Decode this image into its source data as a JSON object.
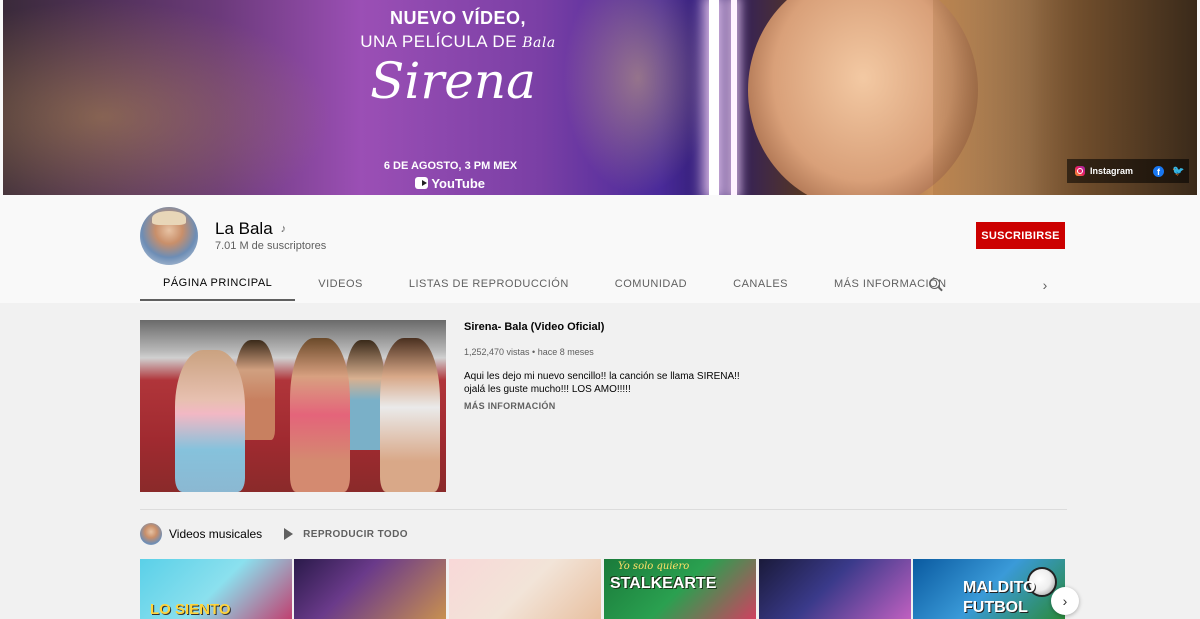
{
  "banner": {
    "line1": "NUEVO VÍDEO,",
    "line2": "UNA PELÍCULA DE",
    "line2_script": "Bala",
    "title_script": "Sirena",
    "date_prefix": "6 DE AGOSTO,",
    "date_time": "3 PM MEX",
    "youtube_label": "YouTube"
  },
  "social": {
    "instagram_label": "Instagram",
    "icons": [
      "instagram-icon",
      "facebook-icon",
      "twitter-icon"
    ]
  },
  "channel": {
    "name": "La Bala",
    "subscribers": "7.01 M de suscriptores",
    "subscribe_label": "SUSCRIBIRSE"
  },
  "tabs": [
    {
      "label": "PÁGINA PRINCIPAL",
      "active": true
    },
    {
      "label": "VIDEOS"
    },
    {
      "label": "LISTAS DE REPRODUCCIÓN"
    },
    {
      "label": "COMUNIDAD"
    },
    {
      "label": "CANALES"
    },
    {
      "label": "MÁS INFORMACIÓN"
    }
  ],
  "featured": {
    "title": "Sirena- Bala (Video Oficial)",
    "meta": "1,252,470 vistas • hace 8 meses",
    "desc_line1": "Aqui les dejo mi nuevo sencillo!! la canción se llama SIRENA!!",
    "desc_line2": "ojalá les guste mucho!!! LOS AMO!!!!!",
    "more_label": "MÁS INFORMACIÓN"
  },
  "shelf": {
    "title": "Videos musicales",
    "play_all_label": "REPRODUCIR TODO",
    "thumbs": [
      {
        "label": "LO SIENTO"
      },
      {
        "label": ""
      },
      {
        "label": ""
      },
      {
        "sub": "Yo solo quiero",
        "label": "STALKEARTE"
      },
      {
        "label": ""
      },
      {
        "label": "MALDITO",
        "label2": "FUTBOL"
      }
    ]
  },
  "colors": {
    "subscribe": "#cc0000",
    "background": "#f9f9f9",
    "content_bg": "#f1f1f1"
  }
}
